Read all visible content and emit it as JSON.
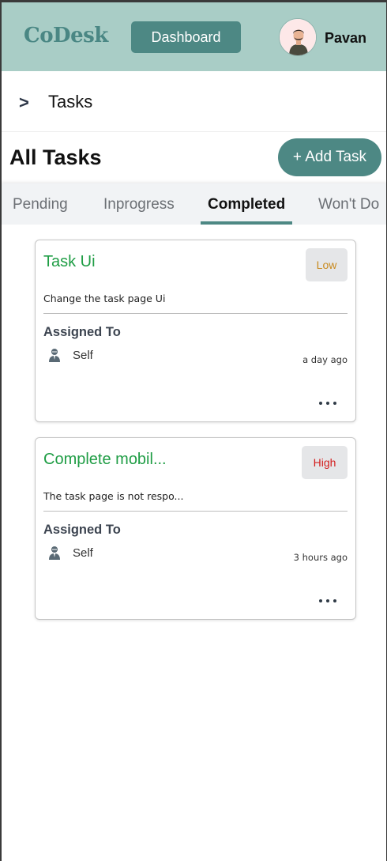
{
  "header": {
    "logo": "CoDesk",
    "dashboard_label": "Dashboard",
    "user_name": "Pavan"
  },
  "breadcrumb": {
    "arrow": ">",
    "label": "Tasks"
  },
  "page": {
    "title": "All Tasks",
    "add_task_label": "+ Add Task"
  },
  "tabs": [
    {
      "label": "Pending",
      "active": false
    },
    {
      "label": "Inprogress",
      "active": false
    },
    {
      "label": "Completed",
      "active": true
    },
    {
      "label": "Won't Do",
      "active": false
    }
  ],
  "tasks": [
    {
      "title": "Task Ui",
      "priority": "Low",
      "description": "Change the task page Ui",
      "assigned_label": "Assigned To",
      "assignee": "Self",
      "time_ago": "a day ago"
    },
    {
      "title": "Complete mobil...",
      "priority": "High",
      "description": "The task page is not respo...",
      "assigned_label": "Assigned To",
      "assignee": "Self",
      "time_ago": "3 hours ago"
    }
  ],
  "colors": {
    "header_bg": "#a9cdc6",
    "accent": "#4d8884",
    "task_title": "#1f9d45",
    "priority_low": "#c98a1e",
    "priority_high": "#d31d1d"
  }
}
